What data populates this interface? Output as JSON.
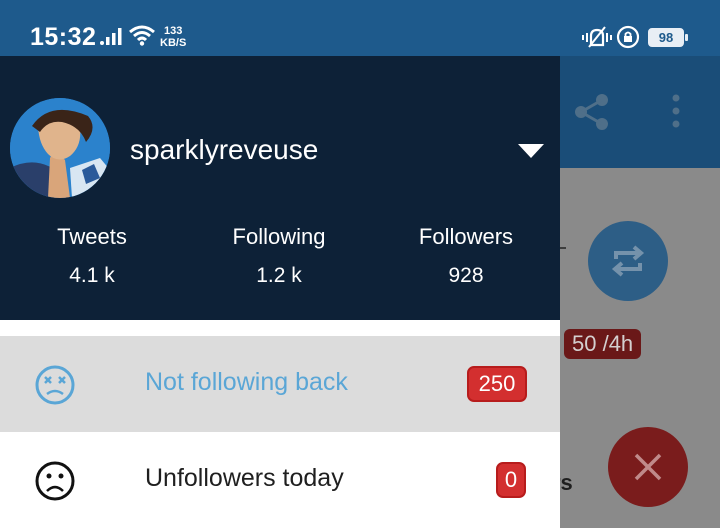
{
  "status_bar": {
    "time": "15:32",
    "speed_value": "133",
    "speed_unit": "KB/S",
    "battery": "98",
    "icons": [
      "signal-icon",
      "wifi-icon",
      "vibrate-icon",
      "rotation-lock-icon",
      "battery-icon"
    ]
  },
  "profile": {
    "username": "sparklyreveuse",
    "stats": [
      {
        "label": "Tweets",
        "value": "4.1 k"
      },
      {
        "label": "Following",
        "value": "1.2 k"
      },
      {
        "label": "Followers",
        "value": "928"
      }
    ]
  },
  "menu": [
    {
      "label": "Not following back",
      "count": "250",
      "icon": "dizzy-face-icon",
      "active": true
    },
    {
      "label": "Unfollowers today",
      "count": "0",
      "icon": "sad-face-icon",
      "active": false
    }
  ],
  "background_app": {
    "rate_limit": "50 /4h",
    "partial_text": "rs",
    "icons": [
      "share-icon",
      "more-vert-icon",
      "retweet-icon",
      "close-icon"
    ]
  },
  "colors": {
    "status_bar": "#1e5a8c",
    "drawer_header": "#0d2137",
    "active_item_bg": "#dcdcdc",
    "active_item_text": "#5aa6d6",
    "badge_red": "#d32f2f"
  }
}
